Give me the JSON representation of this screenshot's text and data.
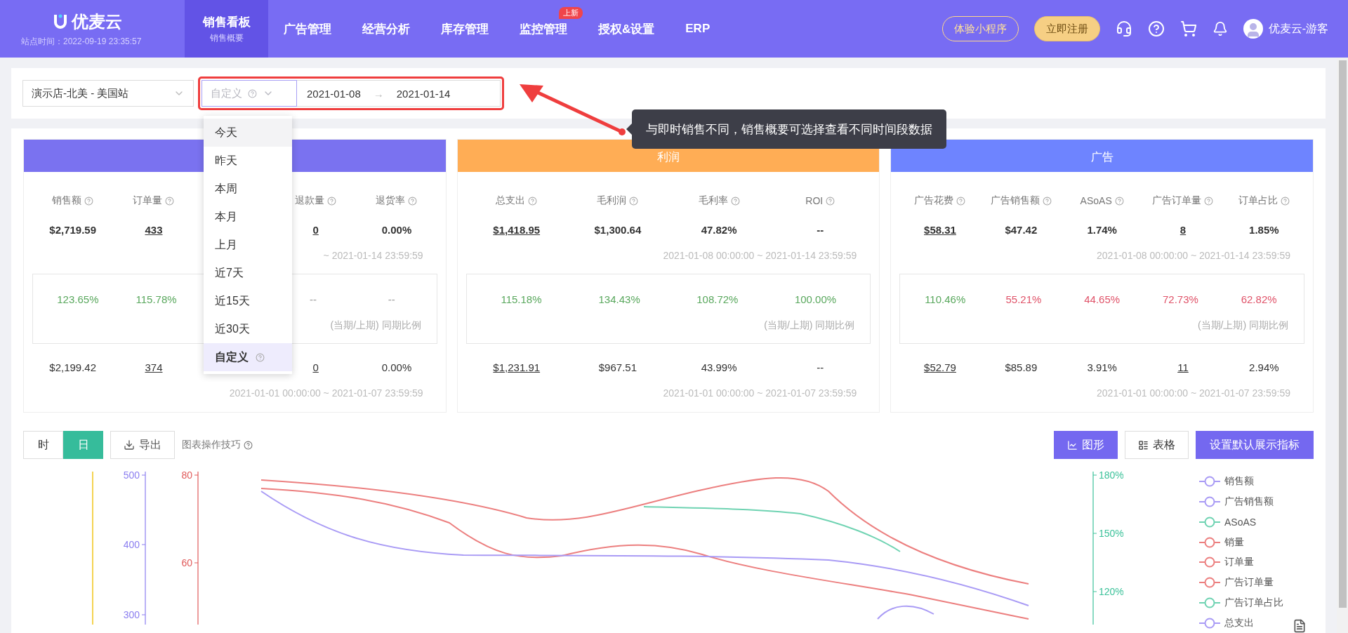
{
  "header": {
    "logo": "优麦云",
    "site_time": "站点时间：2022-09-19 23:35:57",
    "nav": [
      {
        "label": "销售看板",
        "sub": "销售概要",
        "selected": true
      },
      {
        "label": "广告管理",
        "selected": false
      },
      {
        "label": "经营分析",
        "selected": false
      },
      {
        "label": "库存管理",
        "selected": false
      },
      {
        "label": "监控管理",
        "badge": "上新",
        "selected": false
      },
      {
        "label": "授权&设置",
        "selected": false
      },
      {
        "label": "ERP",
        "selected": false
      }
    ],
    "buttons": [
      {
        "label": "体验小程序",
        "kind": "outline"
      },
      {
        "label": "立即注册",
        "kind": "fill"
      }
    ],
    "user": "优麦云-游客"
  },
  "filter": {
    "store": "演示店-北美 - 美国站",
    "range_type": "自定义",
    "start": "2021-01-08",
    "separator": "→",
    "end": "2021-01-14"
  },
  "range_menu": [
    {
      "label": "今天",
      "hovered": true,
      "selected": false
    },
    {
      "label": "昨天",
      "hovered": false,
      "selected": false
    },
    {
      "label": "本周",
      "hovered": false,
      "selected": false
    },
    {
      "label": "本月",
      "hovered": false,
      "selected": false
    },
    {
      "label": "上月",
      "hovered": false,
      "selected": false
    },
    {
      "label": "近7天",
      "hovered": false,
      "selected": false
    },
    {
      "label": "近15天",
      "hovered": false,
      "selected": false
    },
    {
      "label": "近30天",
      "hovered": false,
      "selected": false
    },
    {
      "label": "自定义",
      "hovered": false,
      "selected": true,
      "help": true
    }
  ],
  "callout": "与即时销售不同，销售概要可选择查看不同时间段数据",
  "cards": [
    {
      "color": "#7a72f0",
      "current_range": "~ 2021-01-14 23:59:59",
      "compare_caption": "(当期/上期) 同期比例",
      "previous_range": "2021-01-01 00:00:00 ~ 2021-01-07 23:59:59",
      "metrics": [
        {
          "label": "销售额",
          "current": {
            "value": "$2,719.59",
            "link": false
          },
          "change": {
            "value": "123.65%",
            "color": "#5aa85e"
          },
          "previous": {
            "value": "$2,199.42",
            "link": false
          }
        },
        {
          "label": "订单量",
          "current": {
            "value": "433",
            "link": true
          },
          "change": {
            "value": "115.78%",
            "color": "#5aa85e"
          },
          "previous": {
            "value": "374",
            "link": true
          }
        },
        {
          "kind": "covered"
        },
        {
          "label": "退款量",
          "current": {
            "value": "0",
            "link": true
          },
          "change": {
            "value": "--",
            "color": "#999999"
          },
          "previous": {
            "value": "0",
            "link": true
          }
        },
        {
          "label": "退货率",
          "current": {
            "value": "0.00%",
            "link": false
          },
          "change": {
            "value": "--",
            "color": "#999999"
          },
          "previous": {
            "value": "0.00%",
            "link": false
          }
        }
      ]
    },
    {
      "title": "利润",
      "color": "#ffad55",
      "current_range": "2021-01-08 00:00:00 ~ 2021-01-14 23:59:59",
      "compare_caption": "(当期/上期) 同期比例",
      "previous_range": "2021-01-01 00:00:00 ~ 2021-01-07 23:59:59",
      "metrics": [
        {
          "label": "总支出",
          "current": {
            "value": "$1,418.95",
            "link": true
          },
          "change": {
            "value": "115.18%",
            "color": "#5aa85e"
          },
          "previous": {
            "value": "$1,231.91",
            "link": true
          }
        },
        {
          "label": "毛利润",
          "current": {
            "value": "$1,300.64",
            "link": false
          },
          "change": {
            "value": "134.43%",
            "color": "#5aa85e"
          },
          "previous": {
            "value": "$967.51",
            "link": false
          }
        },
        {
          "label": "毛利率",
          "current": {
            "value": "47.82%",
            "link": false
          },
          "change": {
            "value": "108.72%",
            "color": "#5aa85e"
          },
          "previous": {
            "value": "43.99%",
            "link": false
          }
        },
        {
          "label": "ROI",
          "current": {
            "value": "--",
            "link": false
          },
          "change": {
            "value": "100.00%",
            "color": "#5aa85e"
          },
          "previous": {
            "value": "--",
            "link": false
          }
        }
      ]
    },
    {
      "title": "广告",
      "color": "#6e84ff",
      "current_range": "2021-01-08 00:00:00 ~ 2021-01-14 23:59:59",
      "compare_caption": "(当期/上期) 同期比例",
      "previous_range": "2021-01-01 00:00:00 ~ 2021-01-07 23:59:59",
      "metrics": [
        {
          "label": "广告花费",
          "current": {
            "value": "$58.31",
            "link": true
          },
          "change": {
            "value": "110.46%",
            "color": "#5aa85e"
          },
          "previous": {
            "value": "$52.79",
            "link": true
          }
        },
        {
          "label": "广告销售额",
          "current": {
            "value": "$47.42",
            "link": false
          },
          "change": {
            "value": "55.21%",
            "color": "#e0546a"
          },
          "previous": {
            "value": "$85.89",
            "link": false
          }
        },
        {
          "label": "ASoAS",
          "current": {
            "value": "1.74%",
            "link": false
          },
          "change": {
            "value": "44.65%",
            "color": "#e0546a"
          },
          "previous": {
            "value": "3.91%",
            "link": false
          }
        },
        {
          "label": "广告订单量",
          "current": {
            "value": "8",
            "link": true
          },
          "change": {
            "value": "72.73%",
            "color": "#e0546a"
          },
          "previous": {
            "value": "11",
            "link": true
          }
        },
        {
          "label": "订单占比",
          "current": {
            "value": "1.85%",
            "link": false
          },
          "change": {
            "value": "62.82%",
            "color": "#e0546a"
          },
          "previous": {
            "value": "2.94%",
            "link": false
          }
        }
      ]
    }
  ],
  "chart_toolbar": {
    "granularity": [
      {
        "label": "时",
        "selected": false
      },
      {
        "label": "日",
        "selected": true
      }
    ],
    "export": "导出",
    "tips": "图表操作技巧",
    "views": [
      {
        "label": "图形",
        "kind": "chart",
        "selected": true
      },
      {
        "label": "表格",
        "kind": "table",
        "selected": false
      }
    ],
    "default_button": "设置默认展示指标"
  },
  "chart": {
    "left_axes": [
      {
        "color": "#8b7ef0",
        "ticks": [
          "500",
          "400",
          "300"
        ]
      },
      {
        "color": "#e05a5a",
        "ticks": [
          "80",
          "60"
        ]
      }
    ],
    "right_axes": [
      {
        "color": "#3cc29a",
        "ticks": [
          "180%",
          "150%",
          "120%"
        ]
      }
    ],
    "legend": [
      {
        "label": "销售额",
        "color": "#a99bf5"
      },
      {
        "label": "广告销售额",
        "color": "#a99bf5"
      },
      {
        "label": "ASoAS",
        "color": "#6fd3b2"
      },
      {
        "label": "销量",
        "color": "#ec7f7f"
      },
      {
        "label": "订单量",
        "color": "#ec7f7f"
      },
      {
        "label": "广告订单量",
        "color": "#ec7f7f"
      },
      {
        "label": "广告订单占比",
        "color": "#6fd3b2"
      },
      {
        "label": "总支出",
        "color": "#a99bf5"
      }
    ]
  }
}
